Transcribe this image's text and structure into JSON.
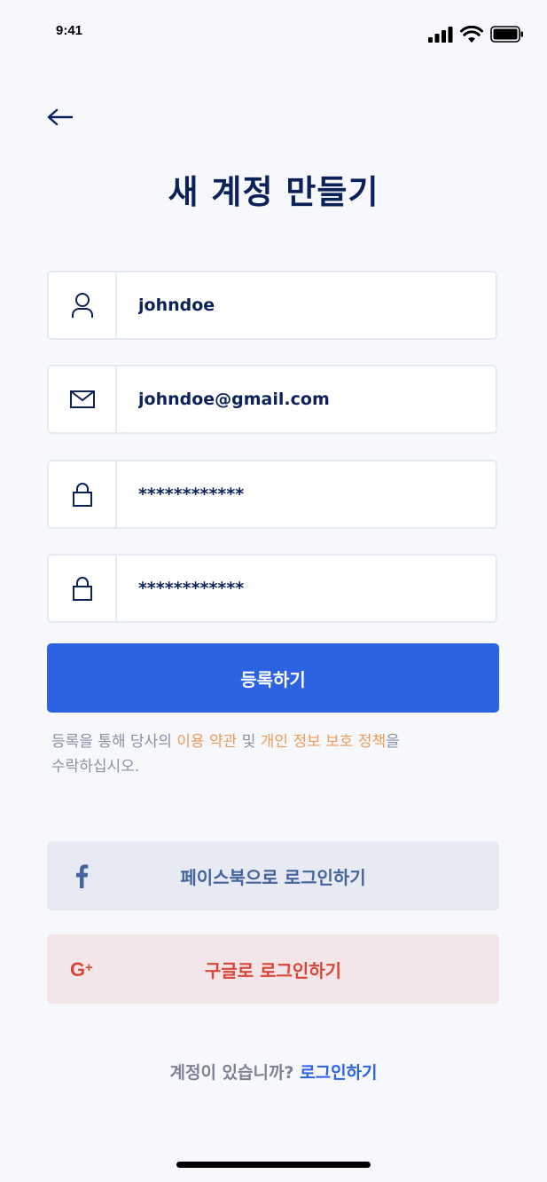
{
  "status_bar": {
    "time": "9:41"
  },
  "header": {
    "title": "새 계정 만들기"
  },
  "form": {
    "username": {
      "value": "johndoe",
      "icon": "user-icon"
    },
    "email": {
      "value": "johndoe@gmail.com",
      "icon": "mail-icon"
    },
    "password": {
      "value": "************",
      "icon": "lock-icon"
    },
    "confirm_password": {
      "value": "************",
      "icon": "lock-icon"
    }
  },
  "register_button": {
    "label": "등록하기",
    "color": "#2b63e3"
  },
  "terms": {
    "prefix": "등록을 통해 당사의 ",
    "terms_link": "이용 약관",
    "middle": " 및 ",
    "privacy_link": "개인 정보 보호 정책",
    "suffix_line1": "을",
    "suffix_line2": "수락하십시오.",
    "link_color": "#f29a58"
  },
  "social": {
    "facebook": {
      "label": "페이스북으로 로그인하기",
      "icon": "facebook-icon",
      "color": "#45649c"
    },
    "google": {
      "label": "구글로 로그인하기",
      "icon": "google-plus-icon",
      "color": "#d94638"
    }
  },
  "footer": {
    "prompt": "계정이 있습니까? ",
    "signin_link": "로그인하기"
  }
}
